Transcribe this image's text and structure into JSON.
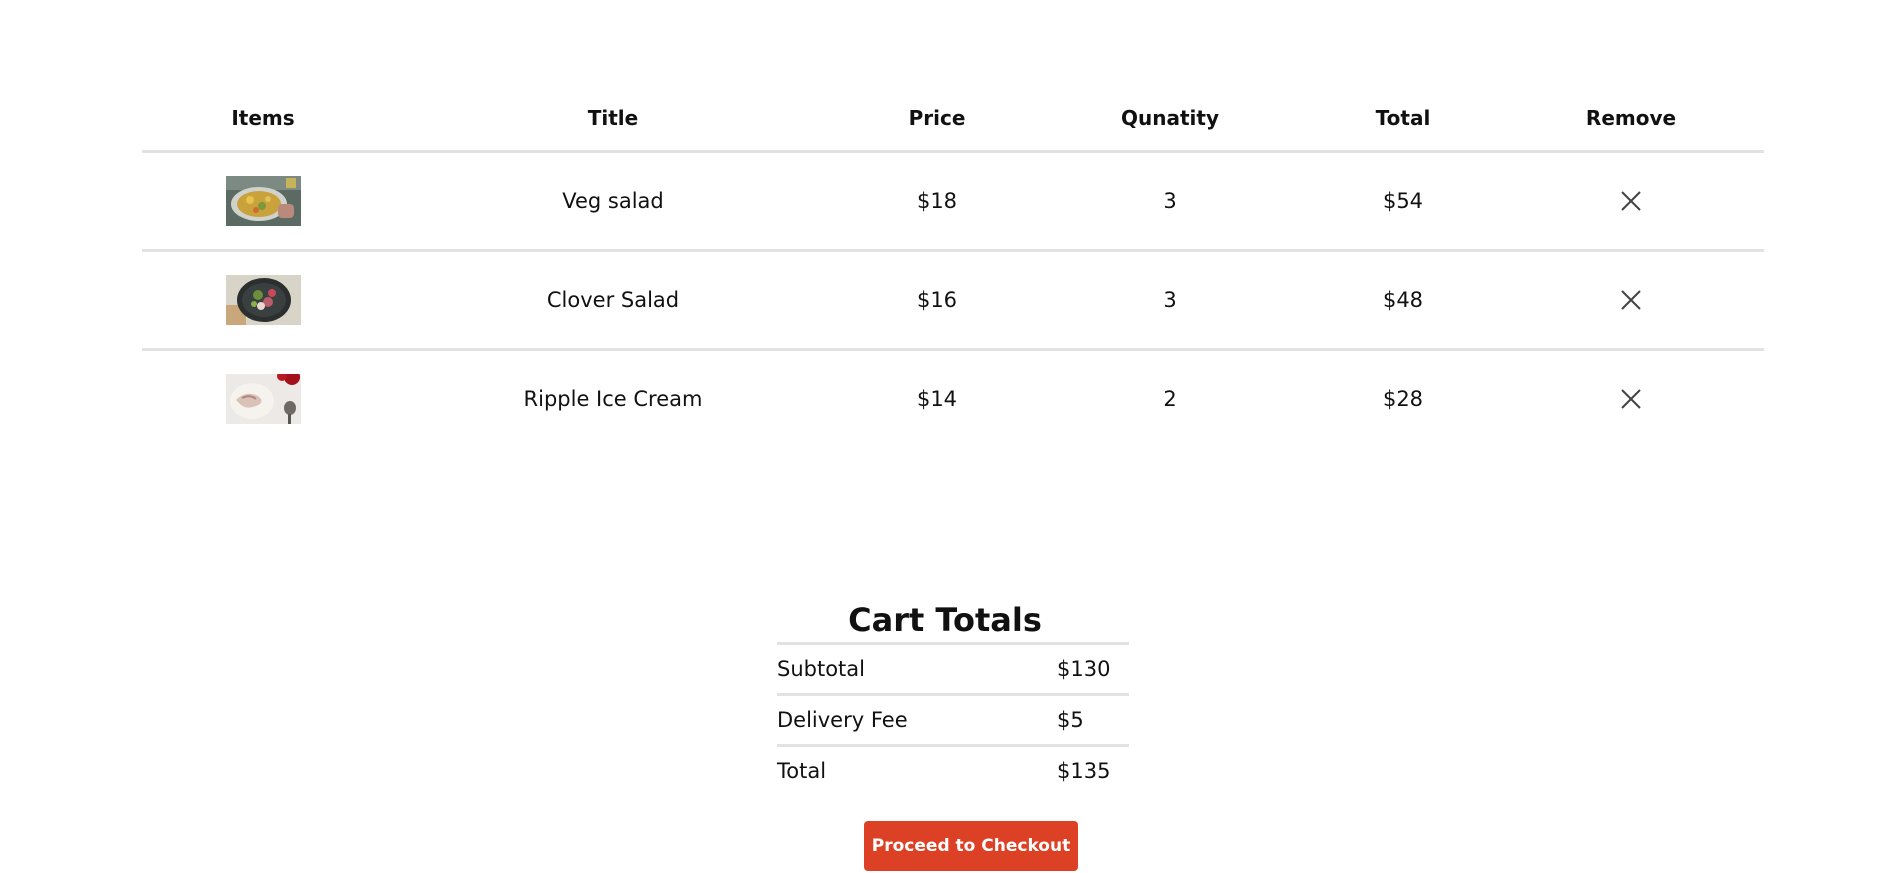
{
  "cart": {
    "headers": [
      "Items",
      "Title",
      "Price",
      "Qunatity",
      "Total",
      "Remove"
    ],
    "items": [
      {
        "image": "veg-salad-photo",
        "title": "Veg salad",
        "price": "$18",
        "quantity": "3",
        "total": "$54"
      },
      {
        "image": "clover-salad-photo",
        "title": "Clover Salad",
        "price": "$16",
        "quantity": "3",
        "total": "$48"
      },
      {
        "image": "ripple-ice-cream-photo",
        "title": "Ripple Ice Cream",
        "price": "$14",
        "quantity": "2",
        "total": "$28"
      }
    ],
    "remove_icon": "close-icon"
  },
  "totals": {
    "title": "Cart Totals",
    "subtotal_label": "Subtotal",
    "subtotal_value": "$130",
    "delivery_label": "Delivery Fee",
    "delivery_value": "$5",
    "total_label": "Total",
    "total_value": "$135"
  },
  "checkout": {
    "label": "Proceed to Checkout",
    "color": "#dc4126"
  }
}
